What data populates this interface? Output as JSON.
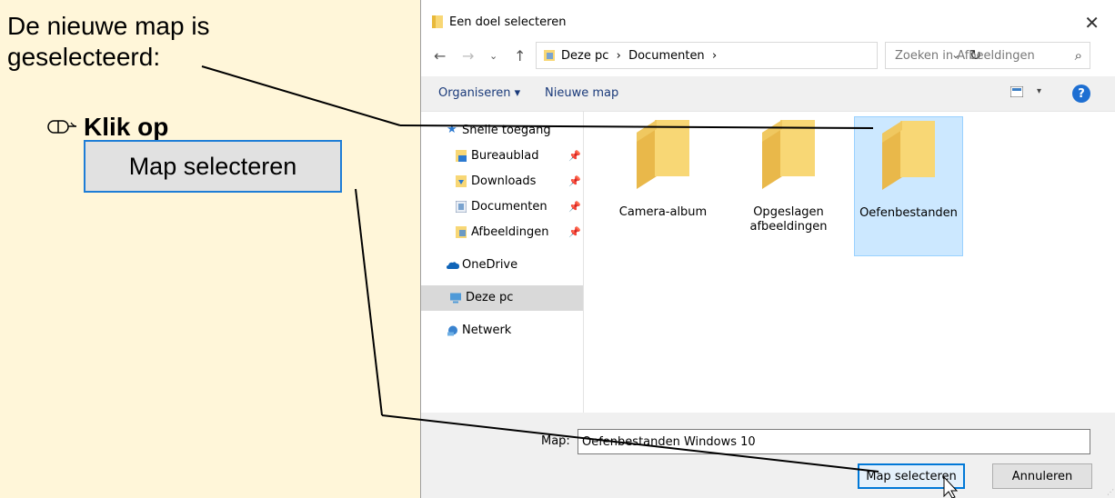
{
  "instruction": {
    "line1": "De nieuwe map is",
    "line2": "geselecteerd:",
    "click_label": "Klik op",
    "button_label": "Map selecteren"
  },
  "dialog": {
    "title": "Een doel selecteren",
    "address": "Deze pc  ›  Documenten  ›",
    "search_placeholder": "Zoeken in Afbeeldingen",
    "toolbar": {
      "organize": "Organiseren ▾",
      "new_folder": "Nieuwe map",
      "help": "?"
    },
    "sidebar": {
      "quick_access": "Snelle toegang",
      "items": [
        {
          "label": "Bureaublad",
          "icon": "desktop-icon",
          "pinned": true
        },
        {
          "label": "Downloads",
          "icon": "downloads-icon",
          "pinned": true
        },
        {
          "label": "Documenten",
          "icon": "documents-icon",
          "pinned": true
        },
        {
          "label": "Afbeeldingen",
          "icon": "pictures-icon",
          "pinned": true
        }
      ],
      "onedrive": "OneDrive",
      "this_pc": "Deze pc",
      "network": "Netwerk"
    },
    "folders": [
      {
        "label": "Camera-album",
        "selected": false
      },
      {
        "label": "Opgeslagen afbeeldingen",
        "selected": false
      },
      {
        "label": "Oefenbestanden",
        "selected": true
      }
    ],
    "map_label": "Map:",
    "map_value": "Oefenbestanden Windows 10",
    "select_button": "Map selecteren",
    "cancel_button": "Annuleren"
  },
  "colors": {
    "instruction_bg": "#fff6d9",
    "accent": "#0078d7",
    "selection_bg": "#cce8ff"
  }
}
